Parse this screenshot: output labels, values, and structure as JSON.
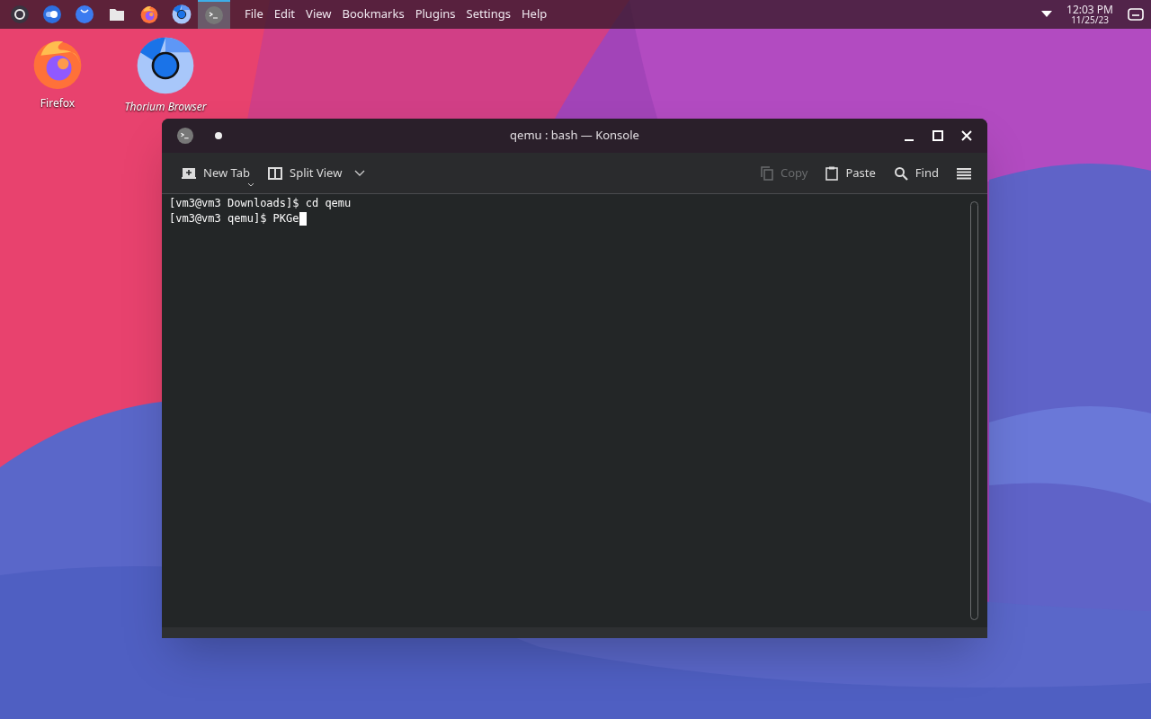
{
  "taskbar": {
    "apps": [
      {
        "kind": "launcher",
        "selected": false
      },
      {
        "kind": "toggle",
        "selected": false
      },
      {
        "kind": "store",
        "selected": false
      },
      {
        "kind": "files",
        "selected": false
      },
      {
        "kind": "firefox",
        "selected": false
      },
      {
        "kind": "thorium",
        "selected": false
      },
      {
        "kind": "terminal",
        "selected": true
      }
    ],
    "menu": [
      "File",
      "Edit",
      "View",
      "Bookmarks",
      "Plugins",
      "Settings",
      "Help"
    ],
    "clock": {
      "time": "12:03 PM",
      "date": "11/25/23"
    }
  },
  "desktop_icons": [
    {
      "kind": "firefox",
      "label": "Firefox"
    },
    {
      "kind": "thorium",
      "label": "Thorium Browser"
    }
  ],
  "window": {
    "title": "qemu : bash — Konsole",
    "toolbar": [
      {
        "kind": "new-tab",
        "label": "New Tab",
        "disabled": false
      },
      {
        "kind": "split-view",
        "label": "Split View",
        "disabled": false
      },
      {
        "kind": "copy",
        "label": "Copy",
        "disabled": true
      },
      {
        "kind": "paste",
        "label": "Paste",
        "disabled": false
      },
      {
        "kind": "find",
        "label": "Find",
        "disabled": false
      }
    ],
    "terminal": {
      "lines": [
        "[vm3@vm3 Downloads]$ cd qemu",
        "[vm3@vm3 qemu]$ PKGe"
      ]
    }
  }
}
